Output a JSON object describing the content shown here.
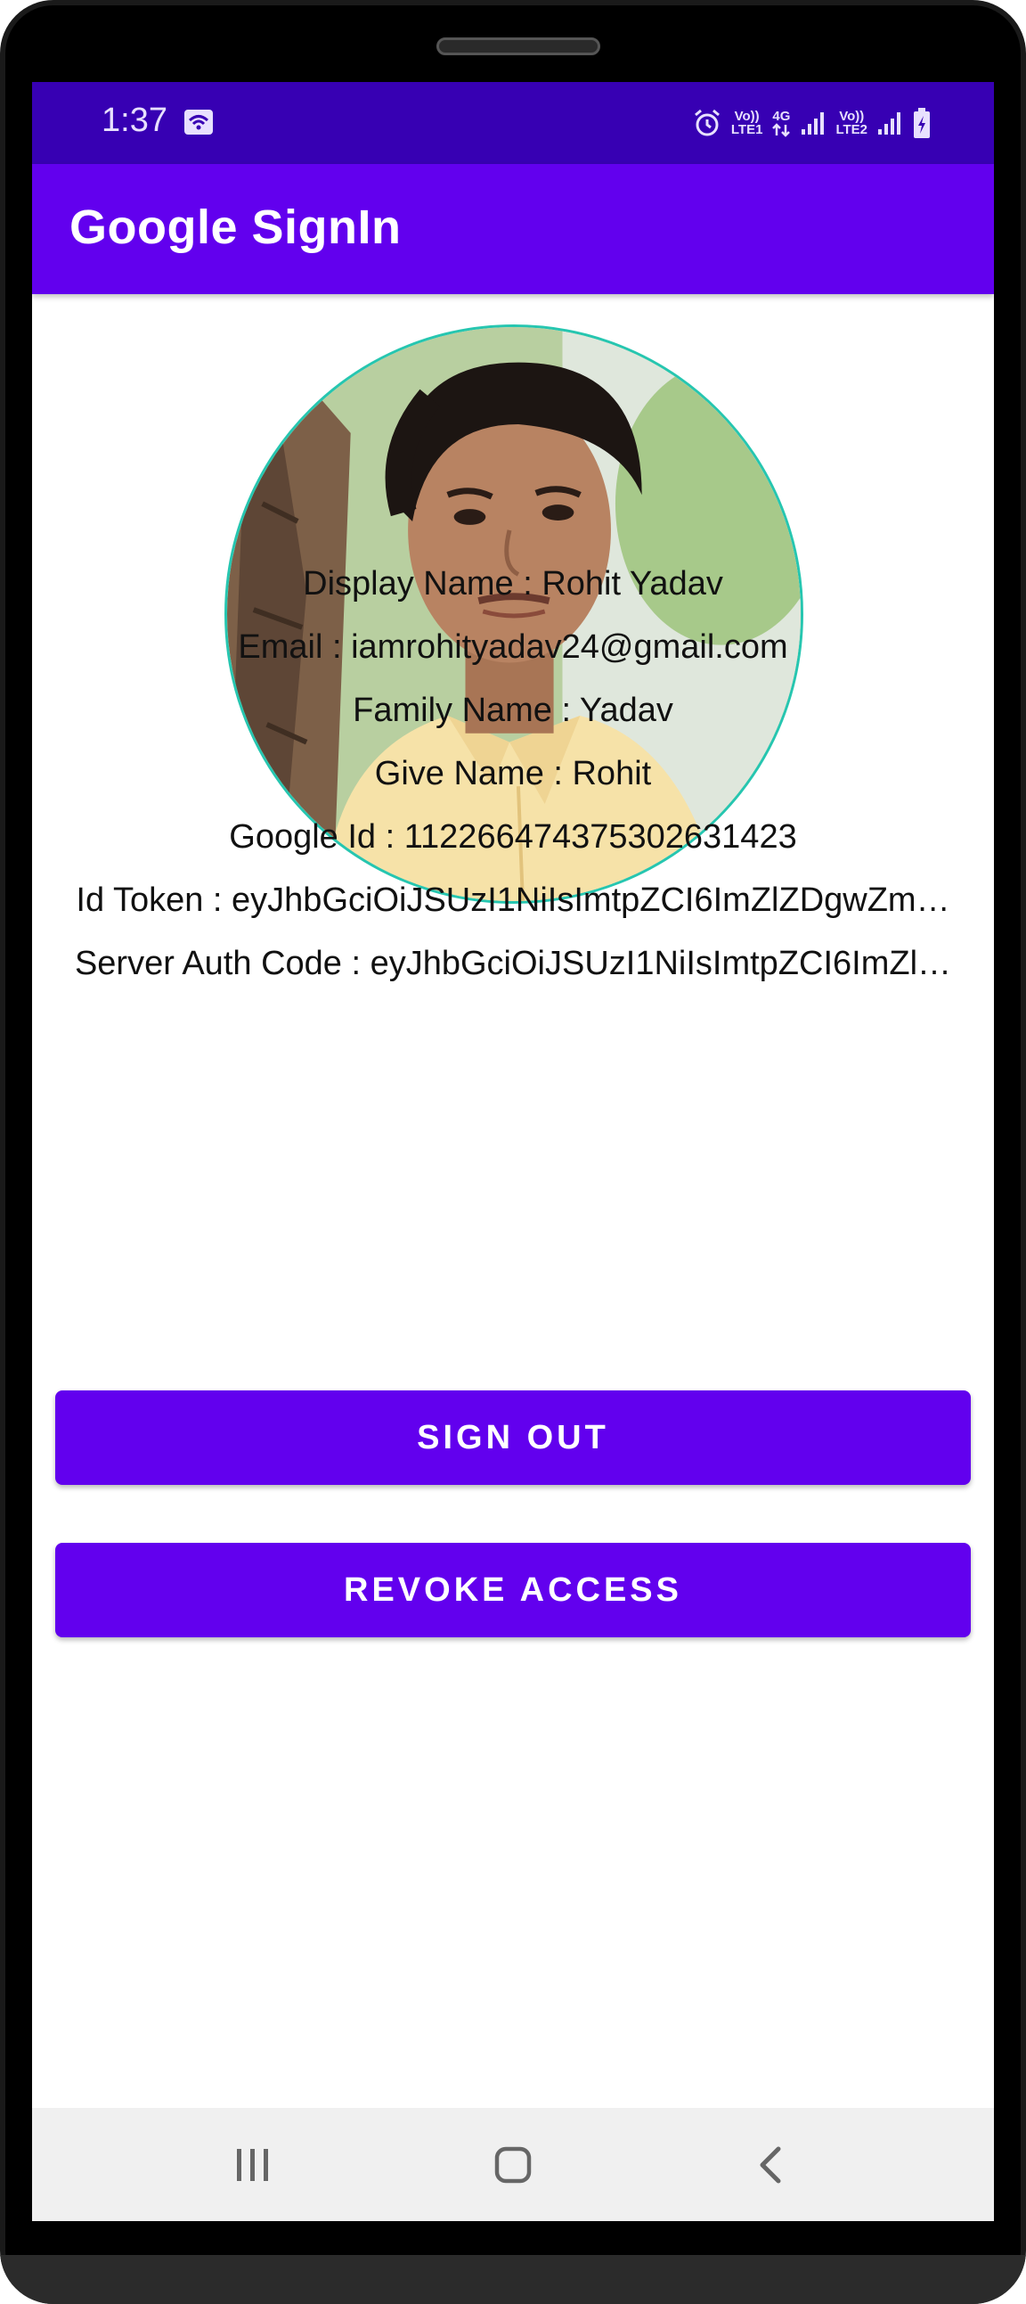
{
  "status_bar": {
    "time": "1:37",
    "icons": [
      "wifi-calling-icon",
      "alarm-icon",
      "volte-lte1-icon",
      "4g-icon",
      "signal-icon",
      "volte-lte2-icon",
      "signal-icon",
      "battery-charging-icon"
    ],
    "net_1_top": "Vo))",
    "net_1_bottom": "LTE1",
    "net_4g": "4G",
    "net_2_top": "Vo))",
    "net_2_bottom": "LTE2"
  },
  "app_bar": {
    "title": "Google SignIn"
  },
  "profile": {
    "display_name": "Display Name : Rohit Yadav",
    "email": "Email : iamrohityadav24@gmail.com",
    "family_name": "Family Name : Yadav",
    "given_name": "Give Name : Rohit",
    "google_id": "Google Id : 112266474375302631423",
    "id_token": "Id Token : eyJhbGciOiJSUzI1NiIsImtpZCI6ImZlZDgwZm…",
    "server_auth_code": "Server Auth Code : eyJhbGciOiJSUzI1NiIsImtpZCI6ImZl…"
  },
  "buttons": {
    "sign_out": "SIGN OUT",
    "revoke_access": "REVOKE ACCESS"
  },
  "colors": {
    "status_bar": "#3700b3",
    "primary": "#6200ee",
    "avatar_border": "#26c6b0",
    "nav_bar": "#f0f0f0"
  },
  "nav_bar": {
    "icons": [
      "recent-apps-icon",
      "home-icon",
      "back-icon"
    ]
  }
}
